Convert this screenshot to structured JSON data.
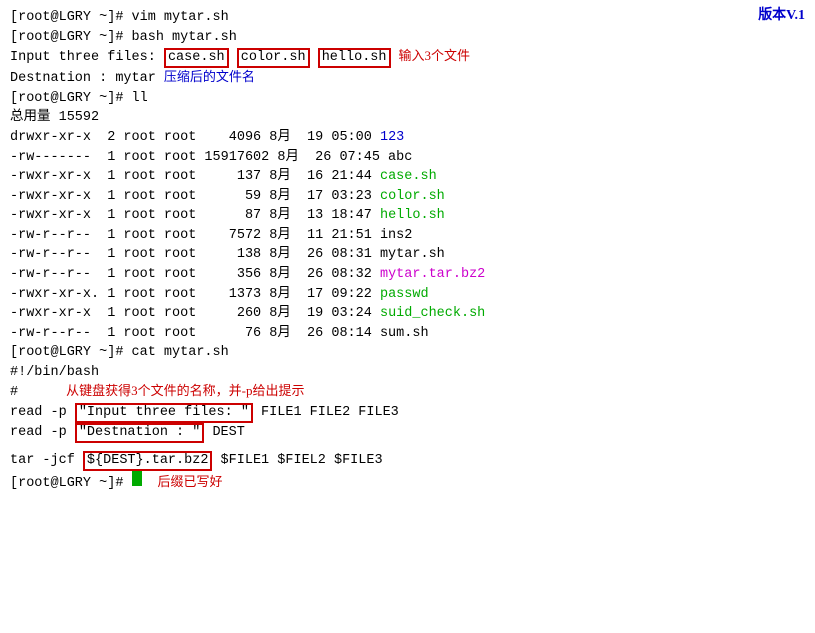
{
  "version": "版本V.1",
  "lines": {
    "cmd1": "[root@LGRY ~]# vim mytar.sh",
    "cmd2": "[root@LGRY ~]# bash mytar.sh",
    "input_prompt": "Input three files: ",
    "input_files": [
      "case.sh",
      "color.sh",
      "hello.sh"
    ],
    "input_annotation": "输入3个文件",
    "dest_line": "Destnation : mytar",
    "dest_annotation": "压缩后的文件名",
    "cmd3": "[root@LGRY ~]# ll",
    "total": "总用量 15592",
    "files": [
      {
        "perms": "drwxr-xr-x",
        "links": " 2",
        "user": "root",
        "group": "root",
        "size": "   4096",
        "month": "8月",
        "day": "19",
        "time": "05:00",
        "name": "123",
        "nameColor": "blue"
      },
      {
        "perms": "-rw-------",
        "links": " 1",
        "user": "root",
        "group": "root",
        "size": "15917602",
        "month": "8月",
        "day": "26",
        "time": "07:45",
        "name": "abc",
        "nameColor": ""
      },
      {
        "perms": "-rwxr-xr-x",
        "links": " 1",
        "user": "root",
        "group": "root",
        "size": "     137",
        "month": "8月",
        "day": "16",
        "time": "21:44",
        "name": "case.sh",
        "nameColor": "green"
      },
      {
        "perms": "-rwxr-xr-x",
        "links": " 1",
        "user": "root",
        "group": "root",
        "size": "      59",
        "month": "8月",
        "day": "17",
        "time": "03:23",
        "name": "color.sh",
        "nameColor": "green"
      },
      {
        "perms": "-rwxr-xr-x",
        "links": " 1",
        "user": "root",
        "group": "root",
        "size": "      87",
        "month": "8月",
        "day": "13",
        "time": "18:47",
        "name": "hello.sh",
        "nameColor": "green"
      },
      {
        "perms": "-rw-r--r--",
        "links": " 1",
        "user": "root",
        "group": "root",
        "size": "    7572",
        "month": "8月",
        "day": "11",
        "time": "21:51",
        "name": "ins2",
        "nameColor": ""
      },
      {
        "perms": "-rw-r--r--",
        "links": " 1",
        "user": "root",
        "group": "root",
        "size": "     138",
        "month": "8月",
        "day": "26",
        "time": "08:31",
        "name": "mytar.sh",
        "nameColor": ""
      },
      {
        "perms": "-rw-r--r--",
        "links": " 1",
        "user": "root",
        "group": "root",
        "size": "     356",
        "month": "8月",
        "day": "26",
        "time": "08:32",
        "name": "mytar.tar.bz2",
        "nameColor": "magenta"
      },
      {
        "perms": "-rwxr-xr-x.",
        "links": " 1",
        "user": "root",
        "group": "root",
        "size": "    1373",
        "month": "8月",
        "day": "17",
        "time": "09:22",
        "name": "passwd",
        "nameColor": "green"
      },
      {
        "perms": "-rwxr-xr-x",
        "links": " 1",
        "user": "root",
        "group": "root",
        "size": "     260",
        "month": "8月",
        "day": "19",
        "time": "03:24",
        "name": "suid_check.sh",
        "nameColor": "green"
      },
      {
        "perms": "-rw-r--r--",
        "links": " 1",
        "user": "root",
        "group": "root",
        "size": "      76",
        "month": "8月",
        "day": "26",
        "time": "08:14",
        "name": "sum.sh",
        "nameColor": ""
      }
    ],
    "cmd4": "[root@LGRY ~]# cat mytar.sh",
    "shebang": "#!/bin/bash",
    "comment": "#",
    "script_annotation": "从键盘获得3个文件的名称，并-p给出提示",
    "read1_pre": "read -p ",
    "read1_quoted": "\"Input three files: \"",
    "read1_post": " FILE1 FILE2 FILE3",
    "read2_pre": "read -p ",
    "read2_quoted": "\"Destnation : \"",
    "read2_post": " DEST",
    "blank": "",
    "tar_pre": "tar -jcf ",
    "tar_dest": "${DEST}.tar.bz2",
    "tar_post": " $FILE1 $FIEL2 $FILE3",
    "cmd5_pre": "[root@LGRY ~]# ",
    "suffix_annotation": "后缀已写好"
  }
}
